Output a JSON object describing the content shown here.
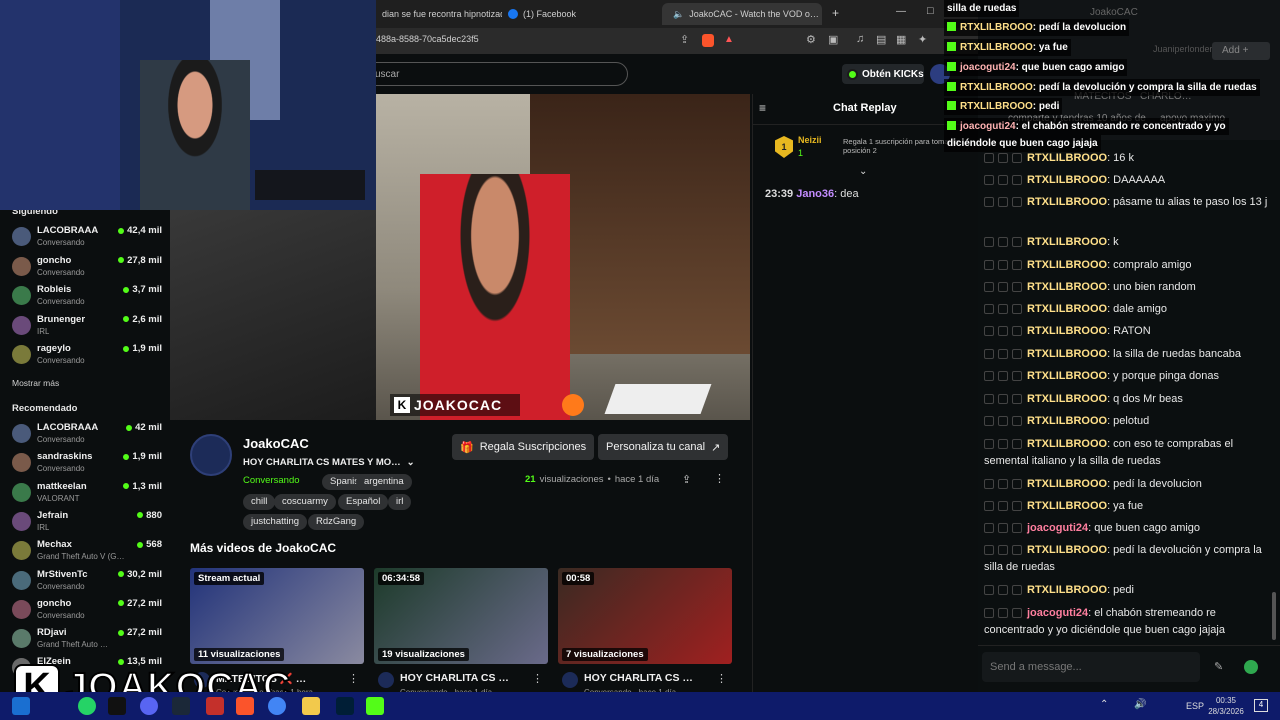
{
  "browser": {
    "tabs": [
      {
        "label": "dian se fue recontra hipnotizad…"
      },
      {
        "label": "(1) Facebook"
      },
      {
        "label": "JoakoCAC - Watch the VOD o…"
      }
    ],
    "url_fragment": "488a-8588-70ca5dec23f5"
  },
  "kick": {
    "search_placeholder": "uscar",
    "get_kicks": "Obtén KICKs",
    "sidebar": {
      "following_header": "Siguiendo",
      "following": [
        {
          "name": "LACOBRAAA",
          "sub": "Conversando",
          "viewers": "42,4 mil"
        },
        {
          "name": "goncho",
          "sub": "Conversando",
          "viewers": "27,8 mil"
        },
        {
          "name": "Robleis",
          "sub": "Conversando",
          "viewers": "3,7 mil"
        },
        {
          "name": "Brunenger",
          "sub": "IRL",
          "viewers": "2,6 mil"
        },
        {
          "name": "rageylo",
          "sub": "Conversando",
          "viewers": "1,9 mil"
        }
      ],
      "show_more": "Mostrar más",
      "recommended_header": "Recomendado",
      "recommended": [
        {
          "name": "LACOBRAAA",
          "sub": "Conversando",
          "viewers": "42 mil"
        },
        {
          "name": "sandraskins",
          "sub": "Conversando",
          "viewers": "1,9 mil"
        },
        {
          "name": "mattkeelan",
          "sub": "VALORANT",
          "viewers": "1,3 mil"
        },
        {
          "name": "Jefrain",
          "sub": "IRL",
          "viewers": "880"
        },
        {
          "name": "Mechax",
          "sub": "Grand Theft Auto V (G…",
          "viewers": "568"
        },
        {
          "name": "MrStivenTc",
          "sub": "Conversando",
          "viewers": "30,2 mil"
        },
        {
          "name": "goncho",
          "sub": "Conversando",
          "viewers": "27,2 mil"
        },
        {
          "name": "RDjavi",
          "sub": "Grand Theft Auto …",
          "viewers": "27,2 mil"
        },
        {
          "name": "ElZeein",
          "sub": "",
          "viewers": "13,5 mil"
        }
      ]
    },
    "channel": {
      "name": "JoakoCAC",
      "title": "HOY CHARLITA CS MATES Y MO…",
      "category": "Conversando",
      "tags": [
        "Spanish",
        "argentina",
        "chill",
        "coscuarmy",
        "Español",
        "irl",
        "justchatting",
        "RdzGang"
      ],
      "views_count": "21",
      "views_label": "visualizaciones",
      "age": "hace 1 día",
      "gift_button": "Regala Suscripciones",
      "customize_button": "Personaliza tu canal",
      "overlay_name": "JOAKOCAC"
    },
    "more_videos": {
      "header": "Más videos de JoakoCAC",
      "cards": [
        {
          "badge": "Stream actual",
          "views": "11 visualizaciones",
          "title": "MATECITOS ❌ …",
          "sub": "Conversando · hace 1 hora"
        },
        {
          "badge": "06:34:58",
          "views": "19 visualizaciones",
          "title": "HOY CHARLITA CS …",
          "sub": "Conversando · hace 1 día"
        },
        {
          "badge": "00:58",
          "views": "7 visualizaciones",
          "title": "HOY CHARLITA CS …",
          "sub": "Conversando · hace 1 día"
        }
      ]
    },
    "chat_replay": {
      "title": "Chat Replay",
      "pinned_user": "Neizii",
      "pinned_count": "1",
      "pinned_text": "Regala 1 suscripción para tomar la posición 2",
      "messages": [
        {
          "time": "23:39",
          "user": "Jano36",
          "text": ": dea"
        }
      ]
    }
  },
  "overlay_chat": [
    {
      "user": "",
      "text": "silla de ruedas",
      "color": "#ffffff"
    },
    {
      "user": "RTXLILBROOO",
      "text": ": pedí la devolucion",
      "color": "#ffe08a"
    },
    {
      "user": "RTXLILBROOO",
      "text": ": ya fue",
      "color": "#ffe08a"
    },
    {
      "user": "joacoguti24",
      "text": ": que buen cago amigo",
      "color": "#ffb3b3"
    },
    {
      "user": "RTXLILBROOO",
      "text": ": pedí la devolución y compra la silla de ruedas",
      "color": "#ffe08a"
    },
    {
      "user": "RTXLILBROOO",
      "text": ": pedi",
      "color": "#ffe08a"
    },
    {
      "user": "joacoguti24",
      "text": ": el chabón stremeando re concentrado y yo",
      "color": "#ffb3b3"
    },
    {
      "user": "",
      "text": "diciéndole que buen cago jajaja",
      "color": "#ffffff"
    }
  ],
  "right_chat": {
    "background_text": [
      "JoakoCAC",
      "Juaniperlonder",
      "Add",
      "MATECITOS",
      "CHARLO…",
      "comparte y tendras 10 años de",
      "apoyo maximo"
    ],
    "messages": [
      {
        "user": "RTXLILBROOO",
        "text": ": 16 k",
        "color": "#ffe08a"
      },
      {
        "user": "RTXLILBROOO",
        "text": ": DAAAAAA",
        "color": "#ffe08a"
      },
      {
        "user": "RTXLILBROOO",
        "text": ": pásame tu alias te paso los 13 j",
        "color": "#ffe08a"
      },
      {
        "user": "RTXLILBROOO",
        "text": ": k",
        "color": "#ffe08a"
      },
      {
        "user": "RTXLILBROOO",
        "text": ": compralo amigo",
        "color": "#ffe08a"
      },
      {
        "user": "RTXLILBROOO",
        "text": ": uno bien random",
        "color": "#ffe08a"
      },
      {
        "user": "RTXLILBROOO",
        "text": ": dale amigo",
        "color": "#ffe08a"
      },
      {
        "user": "RTXLILBROOO",
        "text": ": RATON",
        "color": "#ffe08a"
      },
      {
        "user": "RTXLILBROOO",
        "text": ": la silla de ruedas bancaba",
        "color": "#ffe08a"
      },
      {
        "user": "RTXLILBROOO",
        "text": ": y porque pinga donas",
        "color": "#ffe08a"
      },
      {
        "user": "RTXLILBROOO",
        "text": ": q dos Mr beas",
        "color": "#ffe08a"
      },
      {
        "user": "RTXLILBROOO",
        "text": ": pelotud",
        "color": "#ffe08a"
      },
      {
        "user": "RTXLILBROOO",
        "text": ": con eso te comprabas el semental italiano y la silla de ruedas",
        "color": "#ffe08a"
      },
      {
        "user": "RTXLILBROOO",
        "text": ": pedí la devolucion",
        "color": "#ffe08a"
      },
      {
        "user": "RTXLILBROOO",
        "text": ": ya fue",
        "color": "#ffe08a"
      },
      {
        "user": "joacoguti24",
        "text": ": que buen cago amigo",
        "color": "#ff7f9f"
      },
      {
        "user": "RTXLILBROOO",
        "text": ": pedí la devolución y compra la silla de ruedas",
        "color": "#ffe08a"
      },
      {
        "user": "RTXLILBROOO",
        "text": ": pedi",
        "color": "#ffe08a"
      },
      {
        "user": "joacoguti24",
        "text": ": el chabón stremeando re concentrado y yo diciéndole que buen cago jajaja",
        "color": "#ff7f9f"
      }
    ],
    "input_placeholder": "Send a message..."
  },
  "logo_overlay": "JOAKOCAC",
  "taskbar": {
    "lang": "ESP",
    "time": "00:35",
    "date": "28/3/2026",
    "notif_count": "4"
  },
  "colors": {
    "kick_green": "#53fc18",
    "bg": "#0b0e0f",
    "taskbar": "#0e1b6a"
  }
}
